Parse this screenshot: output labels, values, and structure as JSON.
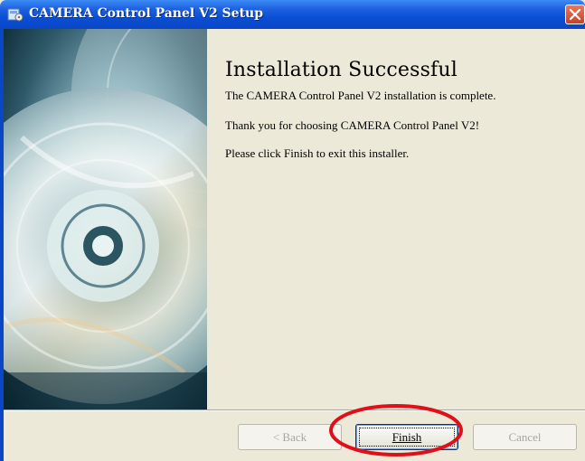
{
  "window": {
    "title": "CAMERA Control Panel V2 Setup"
  },
  "content": {
    "heading": "Installation Successful",
    "lines": [
      "The CAMERA Control Panel V2  installation is complete.",
      "Thank you for choosing CAMERA Control Panel V2!",
      "Please click Finish to exit this installer."
    ]
  },
  "buttons": {
    "back": "< Back",
    "finish": "Finish",
    "cancel": "Cancel"
  },
  "colors": {
    "titlebar": "#0b46c4",
    "highlight": "#e0101a",
    "dialog_bg": "#ece9d8"
  },
  "icons": {
    "app": "setup-icon",
    "close": "close-icon",
    "banner": "cd-disc-image"
  }
}
